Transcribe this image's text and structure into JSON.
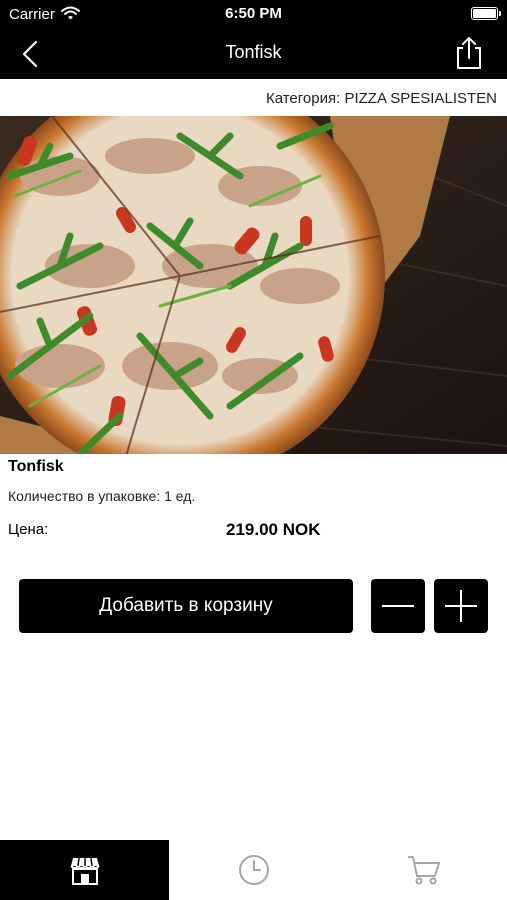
{
  "status_bar": {
    "carrier": "Carrier",
    "time": "6:50 PM"
  },
  "nav": {
    "title": "Tonfisk",
    "back_icon": "chevron-left-icon",
    "share_icon": "share-icon"
  },
  "category_label": "Категория: PIZZA SPESIALISTEN",
  "product": {
    "name": "Tonfisk",
    "quantity_line": "Количество в упаковке: 1 ед.",
    "price_label": "Цена:",
    "price_value": "219.00 NOK"
  },
  "actions": {
    "add_to_cart": "Добавить в корзину",
    "decrease_icon": "minus-icon",
    "increase_icon": "plus-icon"
  },
  "tab_bar": [
    {
      "icon": "store-icon",
      "selected": true
    },
    {
      "icon": "clock-icon",
      "selected": false
    },
    {
      "icon": "cart-icon",
      "selected": false
    }
  ],
  "colors": {
    "bar": "#000000",
    "accent": "#000000",
    "inactive_icon": "#a6a6a6"
  }
}
